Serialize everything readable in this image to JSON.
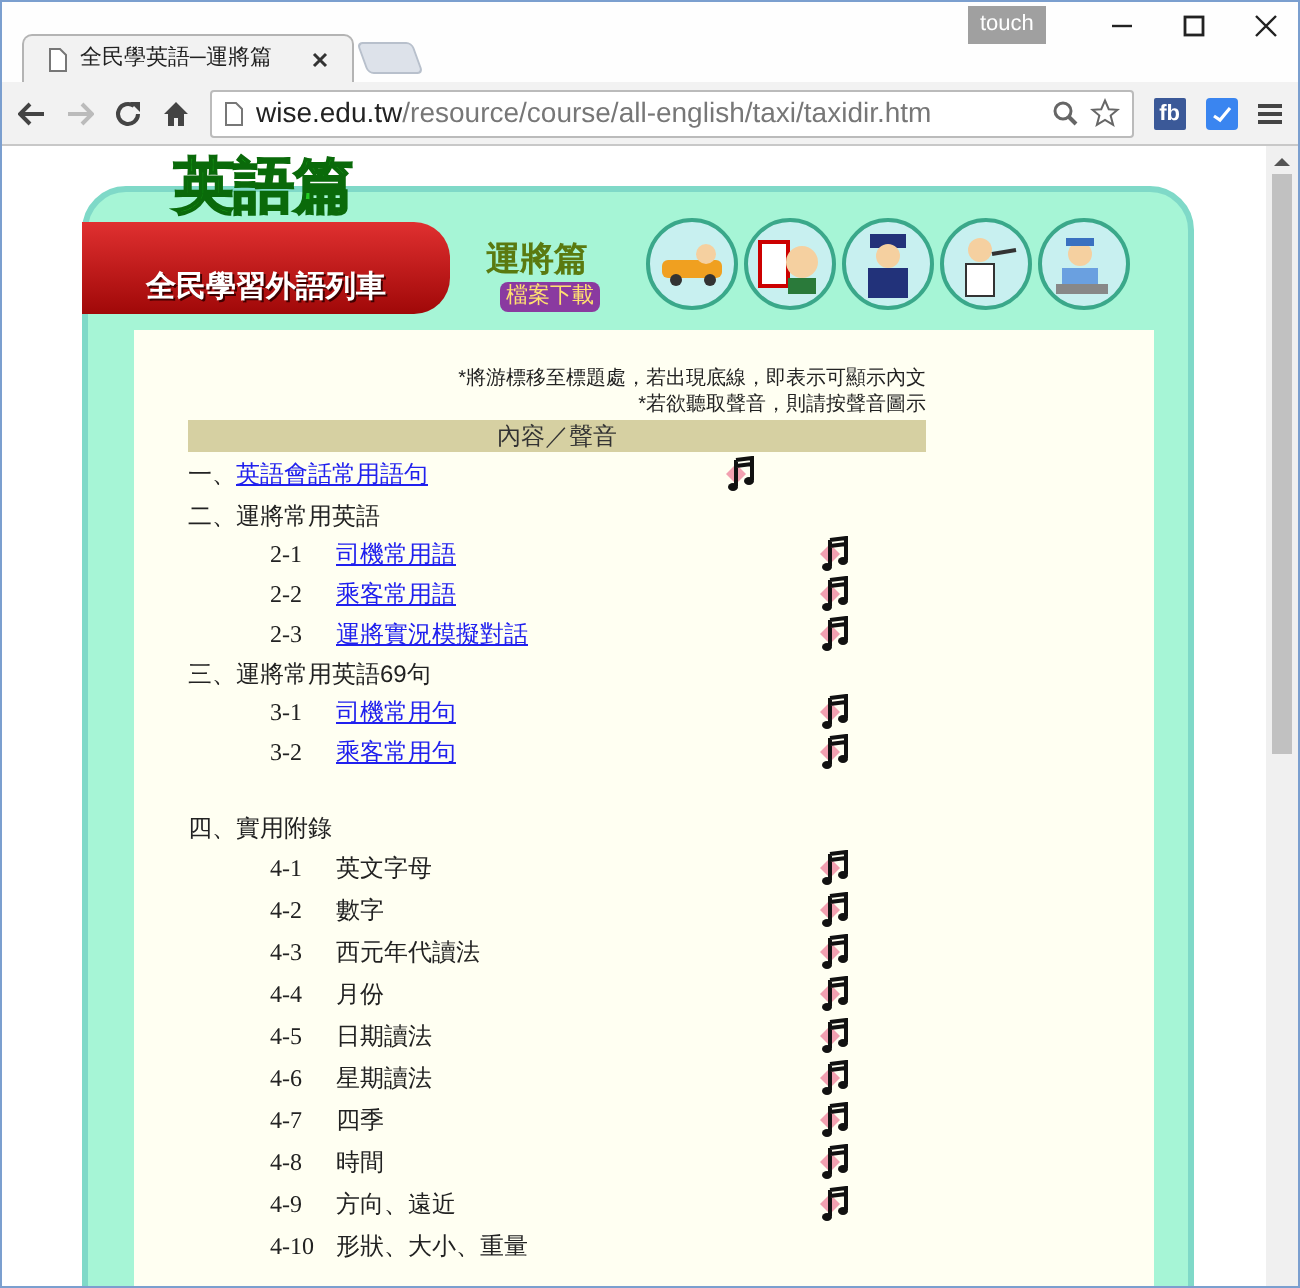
{
  "browser": {
    "tab_title": "全民學英語─運將篇",
    "touch_label": "touch",
    "url_host": "wise.edu.tw",
    "url_path": "/resource/course/all-english/taxi/taxidir.htm",
    "extension_label": "fb"
  },
  "banner": {
    "series_title": "英語篇",
    "train_label": "全民學習外語列車",
    "chapter_title": "運將篇",
    "download_button": "檔案下載"
  },
  "notes": [
    "*將游標移至標題處，若出現底線，即表示可顯示內文",
    "*若欲聽取聲音，則請按聲音圖示"
  ],
  "table_header": "內容／聲音",
  "sections": [
    {
      "number": "一、",
      "title": "英語會話常用語句",
      "link": true,
      "sound": true
    },
    {
      "number": "二、",
      "title": "運將常用英語",
      "link": false,
      "sound": false,
      "items": [
        {
          "number": "2-1",
          "title": "司機常用語",
          "link": true,
          "sound": true
        },
        {
          "number": "2-2",
          "title": "乘客常用語",
          "link": true,
          "sound": true
        },
        {
          "number": "2-3",
          "title": "運將實況模擬對話",
          "link": true,
          "sound": true
        }
      ]
    },
    {
      "number": "三、",
      "title": "運將常用英語69句",
      "link": false,
      "sound": false,
      "items": [
        {
          "number": "3-1",
          "title": "司機常用句",
          "link": true,
          "sound": true
        },
        {
          "number": "3-2",
          "title": "乘客常用句",
          "link": true,
          "sound": true
        }
      ]
    },
    {
      "number": "四、",
      "title": "實用附錄",
      "link": false,
      "sound": false,
      "items": [
        {
          "number": "4-1",
          "title": "英文字母",
          "link": false,
          "sound": true
        },
        {
          "number": "4-2",
          "title": "數字",
          "link": false,
          "sound": true
        },
        {
          "number": "4-3",
          "title": "西元年代讀法",
          "link": false,
          "sound": true
        },
        {
          "number": "4-4",
          "title": "月份",
          "link": false,
          "sound": true
        },
        {
          "number": "4-5",
          "title": "日期讀法",
          "link": false,
          "sound": true
        },
        {
          "number": "4-6",
          "title": "星期讀法",
          "link": false,
          "sound": true
        },
        {
          "number": "4-7",
          "title": "四季",
          "link": false,
          "sound": true
        },
        {
          "number": "4-8",
          "title": "時間",
          "link": false,
          "sound": true
        },
        {
          "number": "4-9",
          "title": "方向、遠近",
          "link": false,
          "sound": true
        },
        {
          "number": "4-10",
          "title": "形狀、大小、重量",
          "link": false,
          "sound": false
        }
      ]
    }
  ]
}
